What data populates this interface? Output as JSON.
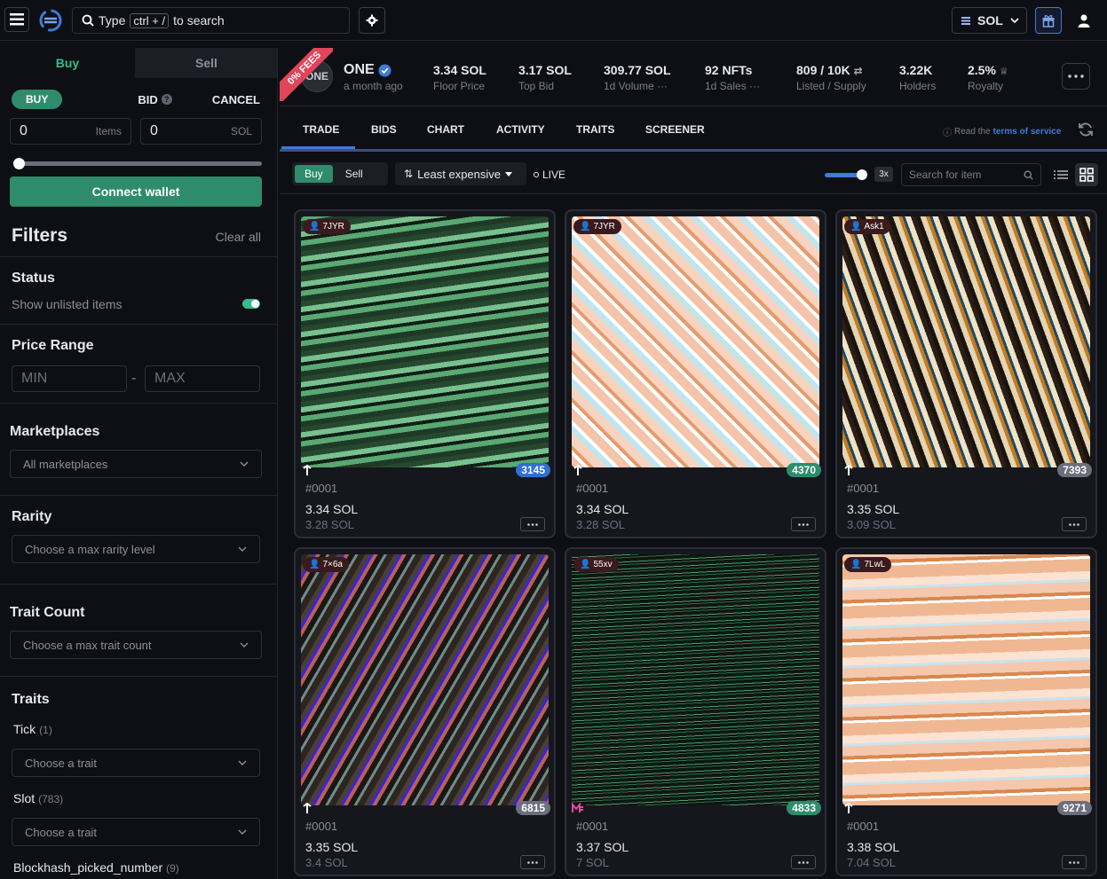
{
  "search": {
    "prefix": "Type",
    "kbd": "ctrl + /",
    "suffix": "to search"
  },
  "currency": {
    "label": "SOL"
  },
  "sidebar": {
    "tabs": [
      "Buy",
      "Sell"
    ],
    "modes": {
      "buy": "BUY",
      "bid": "BID",
      "cancel": "CANCEL"
    },
    "items_field": {
      "value": "0",
      "unit": "Items"
    },
    "sol_field": {
      "value": "0",
      "unit": "SOL"
    },
    "connect_label": "Connect wallet",
    "filters_title": "Filters",
    "clear_all": "Clear all",
    "status": {
      "title": "Status",
      "toggle_label": "Show unlisted items"
    },
    "price_range": {
      "title": "Price Range",
      "min_placeholder": "MIN",
      "max_placeholder": "MAX"
    },
    "marketplaces": {
      "title": "Marketplaces",
      "selected": "All marketplaces"
    },
    "rarity": {
      "title": "Rarity",
      "placeholder": "Choose a max rarity level"
    },
    "trait_count": {
      "title": "Trait Count",
      "placeholder": "Choose a max trait count"
    },
    "traits": {
      "title": "Traits",
      "items": [
        {
          "name": "Tick",
          "count": "(1)",
          "placeholder": "Choose a trait"
        },
        {
          "name": "Slot",
          "count": "(783)",
          "placeholder": "Choose a trait"
        },
        {
          "name": "Blockhash_picked_number",
          "count": "(9)"
        }
      ]
    }
  },
  "collection": {
    "fees_ribbon": "0% FEES",
    "avatar_text": "ONE",
    "name": "ONE",
    "subtitle": "a month ago",
    "stats": [
      {
        "value": "3.34 SOL",
        "label": "Floor Price"
      },
      {
        "value": "3.17 SOL",
        "label": "Top Bid"
      },
      {
        "value": "309.77 SOL",
        "label": "1d Volume"
      },
      {
        "value": "92 NFTs",
        "label": "1d Sales"
      },
      {
        "value": "809 / 10K",
        "label": "Listed / Supply"
      },
      {
        "value": "3.22K",
        "label": "Holders"
      },
      {
        "value": "2.5%",
        "label": "Royalty"
      }
    ]
  },
  "tabs": [
    "TRADE",
    "BIDS",
    "CHART",
    "ACTIVITY",
    "TRAITS",
    "SCREENER"
  ],
  "tos": {
    "prefix": "Read the",
    "link": "terms of service"
  },
  "toolbar": {
    "buy": "Buy",
    "sell": "Sell",
    "sort": "Least expensive",
    "live": "LIVE",
    "zoom": "3x",
    "search_placeholder": "Search for item"
  },
  "cards": [
    {
      "owner": "7JYR",
      "rank": "3145",
      "rank_color": "#2f6fd6",
      "id": "#0001",
      "price": "3.34 SOL",
      "last": "3.28 SOL",
      "market": "tensor"
    },
    {
      "owner": "7JYR",
      "rank": "4370",
      "rank_color": "#2e8c6c",
      "id": "#0001",
      "price": "3.34 SOL",
      "last": "3.28 SOL",
      "market": "tensor"
    },
    {
      "owner": "Ask1",
      "rank": "7393",
      "rank_color": "#6b6f7c",
      "id": "#0001",
      "price": "3.35 SOL",
      "last": "3.09 SOL",
      "market": "tensor"
    },
    {
      "owner": "7×6a",
      "rank": "6815",
      "rank_color": "#6b6f7c",
      "id": "#0001",
      "price": "3.35 SOL",
      "last": "3.4 SOL",
      "market": "tensor"
    },
    {
      "owner": "55xv",
      "rank": "4833",
      "rank_color": "#2e8c6c",
      "id": "#0001",
      "price": "3.37 SOL",
      "last": "7 SOL",
      "market": "magic-eden"
    },
    {
      "owner": "7LwL",
      "rank": "9271",
      "rank_color": "#6b6f7c",
      "id": "#0001",
      "price": "3.38 SOL",
      "last": "7.04 SOL",
      "market": "tensor"
    }
  ],
  "colors": {
    "accent_green": "#2e8c6c",
    "accent_blue": "#3f7bd8",
    "ribbon": "#e0455a"
  }
}
